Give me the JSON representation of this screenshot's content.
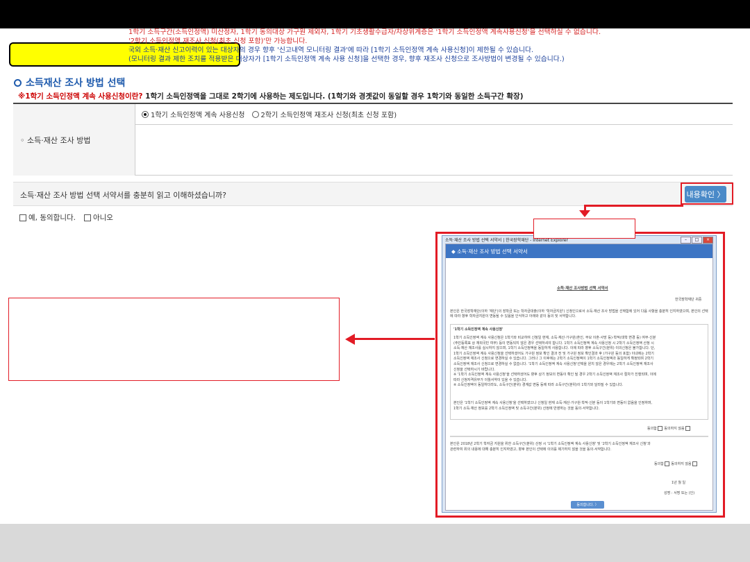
{
  "section": {
    "title": "소득재산 조사 방법 선택",
    "notice_red": "※1학기 소득인정액 계속 사용신청이란?",
    "notice_rest": " 1학기 소득인정액을 그대로 2학기에 사용하는 제도입니다. (1학기와 경곗값이 동일할 경우 1학기와 동일한 소득구간 확장)"
  },
  "table": {
    "header_label": "◦ 소득·재산 조사 방법",
    "radio_options": [
      "1학기 소득인정액 계속 사용신청",
      "2학기 소득인정액 재조사 신청(최초 신청 포함)"
    ],
    "radio_selected": 0,
    "desc_lines": [
      "1학기 소득구간(소득인정액) 미산정자, 1학기 동의대상 가구원 제외자, 1학기 기초생활수급자/차상위계층은 '1학기 소득인정액 계속사용신청'을 선택하실 수 없습니다.",
      "'2학기 소득인정액 재조사 신청(최초 신청 포함)'만 가능합니다.",
      "국외 소득·재산 신고이력이 있는 대상자의 경우 향후 '신고내역 모니터링 결과'에 따라 [1학기 소득인정액 계속 사용신청]이 제한될 수 있습니다.",
      "(모니터링 결과 제한 조치를 적용받은 대상자가 [1학기 소득인정액 계속 사용 신청]을 선택한 경우, 향후 재조사 신청으로 조사방법이 변경될 수 있습니다.)"
    ]
  },
  "confirm": {
    "question": "소득·재산 조사 방법 선택 서약서를 충분히 읽고 이해하셨습니까?",
    "button_label": "내용확인 〉",
    "agree_yes": "예, 동의합니다.",
    "agree_no": "아니오"
  },
  "popup": {
    "window_title": "소득·재산 조사 방법 선택 서약서 | 한국장학재단 - Internet Explorer",
    "header": "◆ 소득·재산 조사 방법 선택 서약서",
    "doc_title": "소득·재산 조사방법 선택 서약서",
    "org": "한국장학재단 귀중",
    "intro": "본인은 한국장학재단(이하 '재단')의 장학금 또는 학자금대출(이하 '학자금지원') 신청인으로서 소득·재산 조사 방법을 선택함에 있어 다음 사항을 충분히 인지하였으며, 본인의 선택에 따라 향후 학자금지원이 변동될 수 있음을 인식하고 아래와 같이 동의 및 서약합니다.",
    "box_title": "'1학기 소득인정액 계속 사용신청'",
    "box_lines": [
      "1학기 소득인정액 계속 사용신청은 1학기와 비교하여 신청일 현재, 소득·재산·가구원(혼인, 부모 이혼·사망 등)·학적(대학 변경 등) 여부·신분",
      "(주민등록표 상 재외국민 여부) 등이 변동되지 않은 경우 선택하셔야 합니다. 1학기 소득인정액 계속 사용신청 시 2학기 소득인정액 산정 시",
      "소득·재산 재조사를 실시하지 않으며, 1학기 소득인정액을 동일하게 사용합니다. 이에 따라 향후 소득구간(분위) 이의신청은 불가합니다. 단,",
      "1학기 소득인정액 계속 사용신청을 선택하셨어도 가구원 정보 확인 결과 전 및 가구원 정보 확인결과 후 (가구원 동의 포함) 이내에는 2학기",
      "소득인정액 재조사 신청으로 변경하실 수 있습니다. 그러나 그 이후에는 2학기 소득인정액이 1학기 소득인정액과 동일하게 확정되며 2학기",
      "소득인정액 재조사 신청으로 변경하실 수 없습니다. '1학기 소득인정액 계속 사용신청'선택을 원치 않은 경우에는 2학기 소득인정액 재조사",
      "신청을 선택하시기 바랍니다.",
      "※ '1학기 소득인정액 계속 사용신청'을 선택하셨어도 향후 상기 정보의 변동이 확인 될 경우 2학기 소득인정액 재조사 절차가 진행되며, 이에",
      "따라 신청자격유무가 이월서약이 있을 수 있습니다.",
      "※ 소득인정액이 동일하더라도, 소득구간(분위) 경계값 변동 등에 따라 소득구간(분위)이 1학기와 달라질 수 있습니다."
    ],
    "para2": [
      "본인은 '1학기 소득인정액 계속 사용신청'을 선택하였으나 신청일 현재 소득·재산·가구원·학적·신분 등이 1학기와 변동이 없음을 인정하며,",
      "1학기 소득·재산 정보를 2학기 소득인정액 및 소득구간(분위) 산정에 반영하는 것을 동의·서약합니다."
    ],
    "agree1": "동의함",
    "disagree1": "동의하지 않음",
    "para3": [
      "본인은 2018년 2학기 학자금 지원을 위한 소득구간(분위) 산정 시 '1학기 소득인정액 계속 사용신청' 및 '2학기 소득인정액 재조사 신청'과",
      "관련하여 위의 내용에 대해 충분히 인지하였고, 향후 본인이 선택에 이의를 제기하지 않을 것을 동의·서약합니다."
    ],
    "agree2": "동의함",
    "disagree2": "동의하지 않음",
    "date_line": "1년        월        일",
    "sign_line": "성명 :              서명 또는 (인)",
    "button": "동의합니다. 〉"
  }
}
